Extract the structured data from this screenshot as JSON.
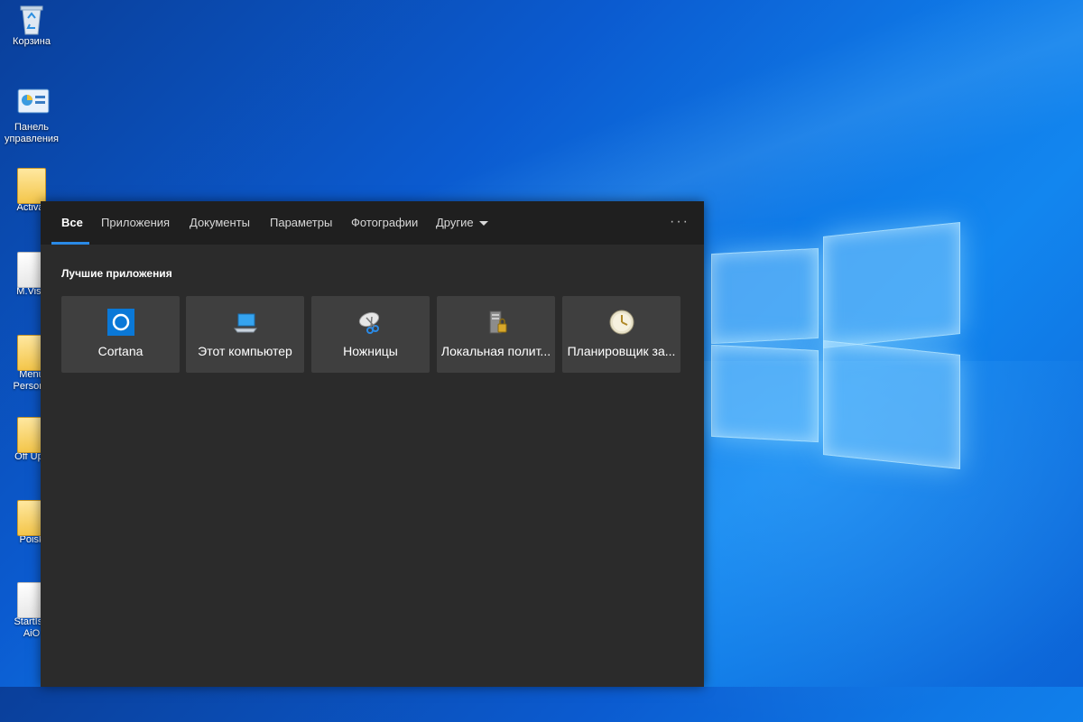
{
  "desktop": {
    "icons": [
      {
        "label": "Корзина",
        "icon": "recycle-bin-icon"
      },
      {
        "label": "Панель управления",
        "icon": "control-panel-icon"
      },
      {
        "label": "Activat",
        "icon": "folder-icon"
      },
      {
        "label": "M.Visu",
        "icon": "folder-icon"
      },
      {
        "label": "Menu Persona",
        "icon": "folder-icon"
      },
      {
        "label": "Off Upd",
        "icon": "folder-icon"
      },
      {
        "label": "Poisk",
        "icon": "folder-icon"
      },
      {
        "label": "StartIsB AiO",
        "icon": "folder-icon"
      }
    ]
  },
  "search": {
    "tabs": [
      {
        "label": "Все",
        "active": true
      },
      {
        "label": "Приложения"
      },
      {
        "label": "Документы"
      },
      {
        "label": "Параметры"
      },
      {
        "label": "Фотографии"
      },
      {
        "label": "Другие",
        "dropdown": true
      }
    ],
    "more_label": "···",
    "section_title": "Лучшие приложения",
    "tiles": [
      {
        "label": "Cortana",
        "icon": "cortana-icon"
      },
      {
        "label": "Этот компьютер",
        "icon": "computer-icon"
      },
      {
        "label": "Ножницы",
        "icon": "scissors-icon"
      },
      {
        "label": "Локальная полит...",
        "icon": "local-policy-icon"
      },
      {
        "label": "Планировщик за...",
        "icon": "task-scheduler-icon"
      }
    ]
  },
  "colors": {
    "accent": "#2a8ae6",
    "panel_bg": "#2b2b2b",
    "tabbar_bg": "#1f1f1f",
    "tile_bg": "#3f3f3f"
  }
}
